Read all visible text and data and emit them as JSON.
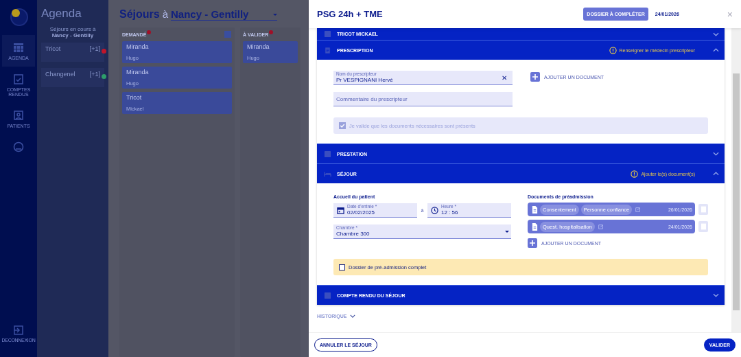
{
  "nav": {
    "items": [
      {
        "kind": "calendar",
        "label": "AGENDA",
        "selected": true
      },
      {
        "kind": "report",
        "label": "COMPTES RENDUS",
        "selected": false
      },
      {
        "kind": "patients",
        "label": "PATIENTS",
        "selected": false
      },
      {
        "kind": "account",
        "selected": false
      }
    ],
    "logout": "DECONNEXION"
  },
  "agenda": {
    "title": "Agenda",
    "subtitle": "Séjours en cours à",
    "place": "Nancy - Gentilly",
    "stays": [
      {
        "name": "Tricot",
        "count": "[+1]",
        "color": "#c0152a"
      },
      {
        "name": "Changenel",
        "count": "[+1]",
        "color": "#2e9e6a"
      }
    ]
  },
  "board": {
    "title": "Séjours",
    "joiner": "à",
    "place": "Nancy - Gentilly",
    "columns": [
      {
        "title": "DEMANDÉ",
        "cards": [
          {
            "name": "Miranda",
            "sub": "Hugo"
          },
          {
            "name": "Miranda",
            "sub": "Hugo"
          },
          {
            "name": "Tricot",
            "sub": "Mickael"
          }
        ]
      },
      {
        "title": "À VALIDER",
        "cards": [
          {
            "name": "Miranda",
            "sub": "Hugo"
          }
        ]
      }
    ]
  },
  "drawer": {
    "title": "PSG 24h + TME",
    "status": "DOSSIER À COMPLÉTER",
    "date": "24/01/2026",
    "close": "×",
    "sections": [
      {
        "kind": "plain",
        "title": "TRICOT MICKAEL",
        "expanded": false
      },
      {
        "kind": "prescription",
        "title": "PRESCRIPTION",
        "expanded": true,
        "warning": "Renseigner le médecin prescripteur"
      },
      {
        "kind": "plain",
        "title": "PRESTATION",
        "expanded": false
      },
      {
        "kind": "sejour",
        "title": "SÉJOUR",
        "expanded": true,
        "warning": "Ajouter le(s) document(s)"
      },
      {
        "kind": "plain",
        "title": "COMPTE RENDU DU SÉJOUR",
        "expanded": false
      }
    ],
    "prescription": {
      "prescriber_label": "Nom du prescripteur",
      "prescriber": "Pr VESPIGNANI Hervé",
      "clear": "✕",
      "comment_placeholder": "Commentaire du prescripteur",
      "add_document": "AJOUTER UN DOCUMENT",
      "validation": {
        "label": "Je valide que les documents nécessaires sont présents",
        "checked": true,
        "disabled": true
      }
    },
    "sejour": {
      "reception_title": "Accueil du patient",
      "date_label": "Date d'entrée *",
      "date": "02/02/2025",
      "joiner": "à",
      "time_label": "Heure *",
      "time": "12 : 56",
      "room_label": "Chambre *",
      "room": "Chambre 300",
      "documents_title": "Documents de préadmission",
      "documents": [
        {
          "tags": [
            "Consentement",
            "Personne confiance"
          ],
          "date": "26/01/2026"
        },
        {
          "tags": [
            "Quest. hospitalisation"
          ],
          "date": "24/01/2026"
        }
      ],
      "add_document": "AJOUTER UN DOCUMENT",
      "complete": {
        "label": "Dossier de pré-admission complet",
        "checked": false
      }
    },
    "history": "HISTORIQUE",
    "cancel": "ANNULER LE SÉJOUR",
    "submit": "VALIDER"
  }
}
